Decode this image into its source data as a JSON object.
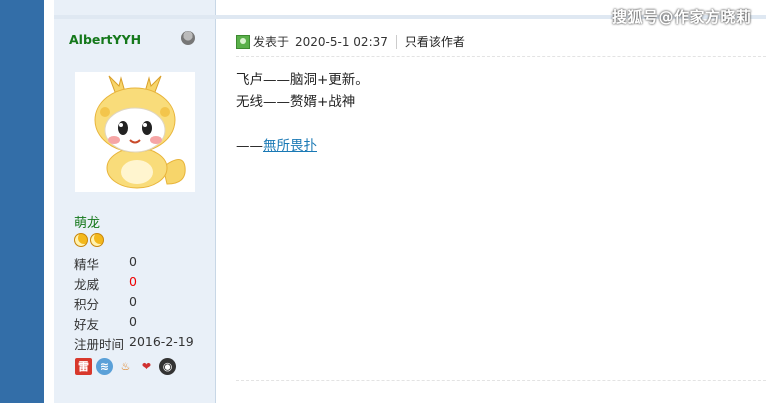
{
  "watermark": "搜狐号@作家方晓莉",
  "author": {
    "name": "AlbertYYH",
    "rank": "萌龙",
    "stats": [
      {
        "label": "精华",
        "value": "0"
      },
      {
        "label": "龙威",
        "value": "0"
      },
      {
        "label": "积分",
        "value": "0"
      },
      {
        "label": "好友",
        "value": "0"
      },
      {
        "label": "注册时间",
        "value": "2016-2-19"
      }
    ],
    "icons": [
      "online-status-icon",
      "dragon-avatar-image",
      "rank-star-icon",
      "medal-icons"
    ]
  },
  "post": {
    "posted_label": "发表于",
    "date": "2020-5-1 02:37",
    "only_author_label": "只看该作者",
    "lines": [
      "飞卢——脑洞+更新。",
      "无线——赘婿+战神"
    ],
    "signature_prefix": "——",
    "signature_link": "無所畏扑"
  },
  "colors": {
    "left_bar": "#336ea8",
    "username": "#15781b",
    "link": "#1a79b5",
    "red_value": "#e00000"
  }
}
